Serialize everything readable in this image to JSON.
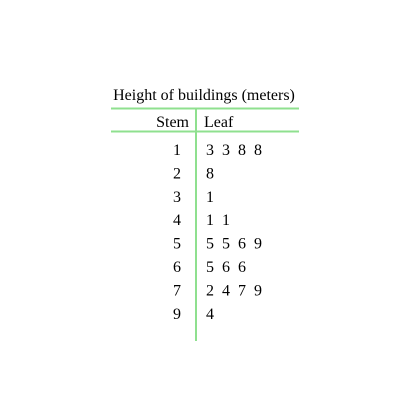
{
  "chart_data": {
    "type": "table",
    "title": "Height of buildings (meters)",
    "columns": [
      "Stem",
      "Leaf"
    ],
    "rows": [
      {
        "stem": "1",
        "leaves": [
          "3",
          "3",
          "8",
          "8"
        ]
      },
      {
        "stem": "2",
        "leaves": [
          "8"
        ]
      },
      {
        "stem": "3",
        "leaves": [
          "1"
        ]
      },
      {
        "stem": "4",
        "leaves": [
          "1",
          "1"
        ]
      },
      {
        "stem": "5",
        "leaves": [
          "5",
          "5",
          "6",
          "9"
        ]
      },
      {
        "stem": "6",
        "leaves": [
          "5",
          "6",
          "6"
        ]
      },
      {
        "stem": "7",
        "leaves": [
          "2",
          "4",
          "7",
          "9"
        ]
      },
      {
        "stem": "9",
        "leaves": [
          "4"
        ]
      }
    ]
  },
  "style": {
    "rule_color": "#8fe08f",
    "text_color": "#000000"
  }
}
